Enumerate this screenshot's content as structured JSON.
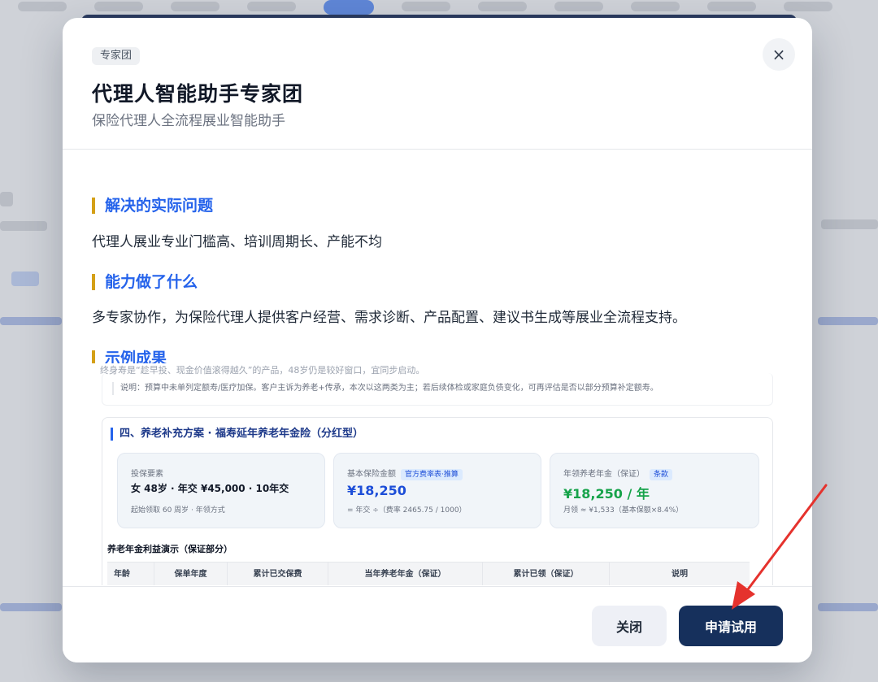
{
  "modal": {
    "tag": "专家团",
    "title": "代理人智能助手专家团",
    "subtitle": "保险代理人全流程展业智能助手",
    "close_icon": "×"
  },
  "sections": [
    {
      "title": "解决的实际问题",
      "text": "代理人展业专业门槛高、培训周期长、产能不均"
    },
    {
      "title": "能力做了什么",
      "text": "多专家协作，为保险代理人提供客户经营、需求诊断、产品配置、建议书生成等展业全流程支持。"
    },
    {
      "title": "示例成果"
    }
  ],
  "preview": {
    "faded_text": "终身寿是“趁早投、现金价值滚得越久”的产品，48岁仍是较好窗口，宜同步启动。",
    "note": "说明：预算中未单列定额寿/医疗加保。客户主诉为养老+传承，本次以这两类为主；若后续体检或家庭负债变化，可再评估是否以部分预算补定额寿。",
    "plan_title": "四、养老补充方案 · 福寿延年养老年金险（分红型）",
    "cards": [
      {
        "label": "投保要素",
        "main": "女 48岁 · 年交 ¥45,000 · 10年交",
        "sub": "起始领取 60 周岁 · 年领方式"
      },
      {
        "label": "基本保险金额",
        "badge": "官方费率表·推算",
        "main": "¥18,250",
        "sub": "= 年交 ÷（费率 2465.75 / 1000）"
      },
      {
        "label": "年领养老年金（保证）",
        "badge": "条款",
        "main": "¥18,250 / 年",
        "sub": "月领 ≈ ¥1,533（基本保额×8.4%）"
      }
    ],
    "table_title": "养老年金利益演示（保证部分）",
    "table_headers": [
      "年龄",
      "保单年度",
      "累计已交保费",
      "当年养老年金（保证）",
      "累计已领（保证）",
      "说明"
    ]
  },
  "footer": {
    "close_label": "关闭",
    "apply_label": "申请试用"
  },
  "colors": {
    "accent_blue": "#2563eb",
    "section_bar": "#d4a017",
    "primary_button": "#16305c",
    "annotation_arrow": "#e5322d"
  }
}
